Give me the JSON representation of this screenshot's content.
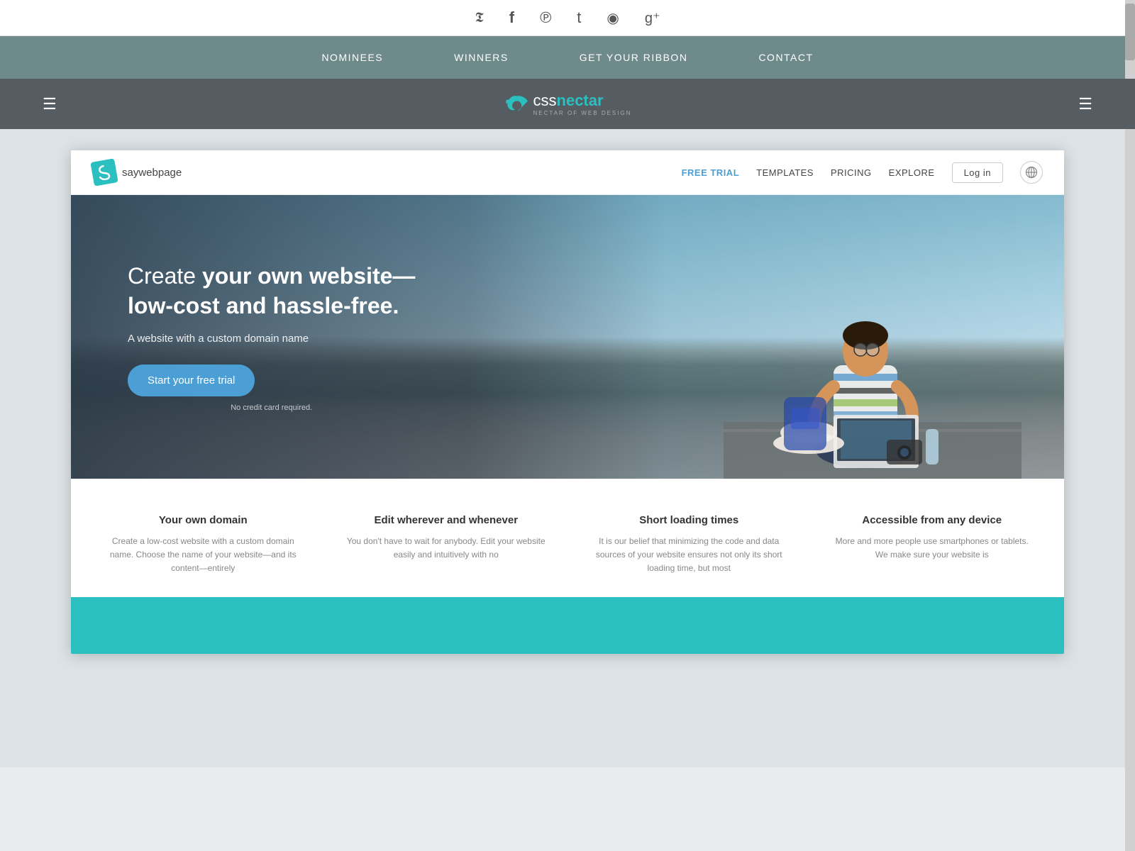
{
  "social": {
    "icons": [
      {
        "name": "twitter-icon",
        "symbol": "𝕏",
        "unicode": "🐦"
      },
      {
        "name": "facebook-icon",
        "symbol": "f"
      },
      {
        "name": "pinterest-icon",
        "symbol": "P"
      },
      {
        "name": "tumblr-icon",
        "symbol": "t"
      },
      {
        "name": "rss-icon",
        "symbol": "◉"
      },
      {
        "name": "googleplus-icon",
        "symbol": "g+"
      }
    ]
  },
  "nav": {
    "items": [
      {
        "label": "NOMINEES",
        "href": "#"
      },
      {
        "label": "WINNERS",
        "href": "#"
      },
      {
        "label": "GET YOUR RIBBON",
        "href": "#"
      },
      {
        "label": "CONTACT",
        "href": "#"
      }
    ]
  },
  "cssnectar": {
    "title_css": "css",
    "title_nectar": "nectar",
    "tagline": "NECTAR OF WEB DESIGN",
    "hamburger_label": "☰"
  },
  "site": {
    "logo_text": "saywebpage",
    "logo_letter": "S",
    "nav_links": [
      {
        "label": "FREE TRIAL",
        "class": "free-trial"
      },
      {
        "label": "TEMPLATES",
        "class": ""
      },
      {
        "label": "PRICING",
        "class": ""
      },
      {
        "label": "EXPLORE",
        "class": ""
      },
      {
        "label": "Log in",
        "class": "login-btn"
      },
      {
        "label": "🌐",
        "class": "globe-btn"
      }
    ]
  },
  "hero": {
    "headline_normal": "Create ",
    "headline_bold": "your own website—",
    "headline_line2": "low-cost and hassle-free.",
    "subtitle": "A website with a custom domain name",
    "cta_button": "Start your free trial",
    "no_credit": "No credit card required."
  },
  "features": [
    {
      "title": "Your own domain",
      "description": "Create a low-cost website with a custom domain name. Choose the name of your website—and its content—entirely"
    },
    {
      "title": "Edit wherever and whenever",
      "description": "You don't have to wait for anybody. Edit your website easily and intuitively with no"
    },
    {
      "title": "Short loading times",
      "description": "It is our belief that minimizing the code and data sources of your website ensures not only its short loading time, but most"
    },
    {
      "title": "Accessible from any device",
      "description": "More and more people use smartphones or tablets. We make sure your website is"
    }
  ]
}
